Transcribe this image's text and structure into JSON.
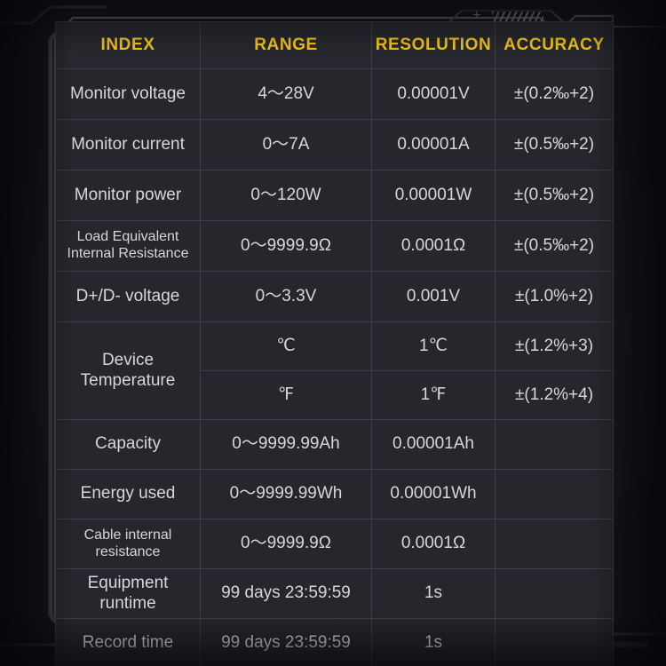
{
  "panel": {
    "accent_color": "#f6c516",
    "text_color": "#d6d7da",
    "border_color": "#3d3f46",
    "cell_bg": "#26272c",
    "page_bg": "#1b1c21"
  },
  "decoration": {
    "plus_glyph": "+",
    "hatch_name": "diagonal-hatch-marks"
  },
  "table": {
    "columns": [
      "INDEX",
      "RANGE",
      "RESOLUTION",
      "ACCURACY"
    ],
    "rows": [
      {
        "index": "Monitor voltage",
        "index_lines": [
          "Monitor voltage"
        ],
        "range": "4～28V",
        "resolution": "0.00001V",
        "accuracy": "±(0.2‰+2)"
      },
      {
        "index": "Monitor current",
        "index_lines": [
          "Monitor current"
        ],
        "range": "0～7A",
        "resolution": "0.00001A",
        "accuracy": "±(0.5‰+2)"
      },
      {
        "index": "Monitor power",
        "index_lines": [
          "Monitor power"
        ],
        "range": "0～120W",
        "resolution": "0.00001W",
        "accuracy": "±(0.5‰+2)"
      },
      {
        "index": "Load Equivalent Internal Resistance",
        "index_lines": [
          "Load Equivalent",
          "Internal Resistance"
        ],
        "range": "0～9999.9Ω",
        "resolution": "0.0001Ω",
        "accuracy": "±(0.5‰+2)"
      },
      {
        "index": "D+/D- voltage",
        "index_lines": [
          "D+/D- voltage"
        ],
        "range": "0～3.3V",
        "resolution": "0.001V",
        "accuracy": "±(1.0%+2)"
      },
      {
        "index": "Device Temperature",
        "index_lines": [
          "Device",
          "Temperature"
        ],
        "rowspan": 2,
        "range": "℃",
        "resolution": "1℃",
        "accuracy": "±(1.2%+3)"
      },
      {
        "index": "",
        "index_lines": [],
        "range": "℉",
        "resolution": "1℉",
        "accuracy": "±(1.2%+4)"
      },
      {
        "index": "Capacity",
        "index_lines": [
          "Capacity"
        ],
        "range": "0～9999.99Ah",
        "resolution": "0.00001Ah",
        "accuracy": ""
      },
      {
        "index": "Energy used",
        "index_lines": [
          "Energy used"
        ],
        "range": "0～9999.99Wh",
        "resolution": "0.00001Wh",
        "accuracy": ""
      },
      {
        "index": "Cable internal resistance",
        "index_lines": [
          "Cable internal",
          "resistance"
        ],
        "range": "0～9999.9Ω",
        "resolution": "0.0001Ω",
        "accuracy": ""
      },
      {
        "index": "Equipment runtime",
        "index_lines": [
          "Equipment",
          "runtime"
        ],
        "range": "99 days 23:59:59",
        "resolution": "1s",
        "accuracy": ""
      },
      {
        "index": "Record time",
        "index_lines": [
          "Record time"
        ],
        "range": "99 days 23:59:59",
        "resolution": "1s",
        "accuracy": ""
      }
    ]
  }
}
